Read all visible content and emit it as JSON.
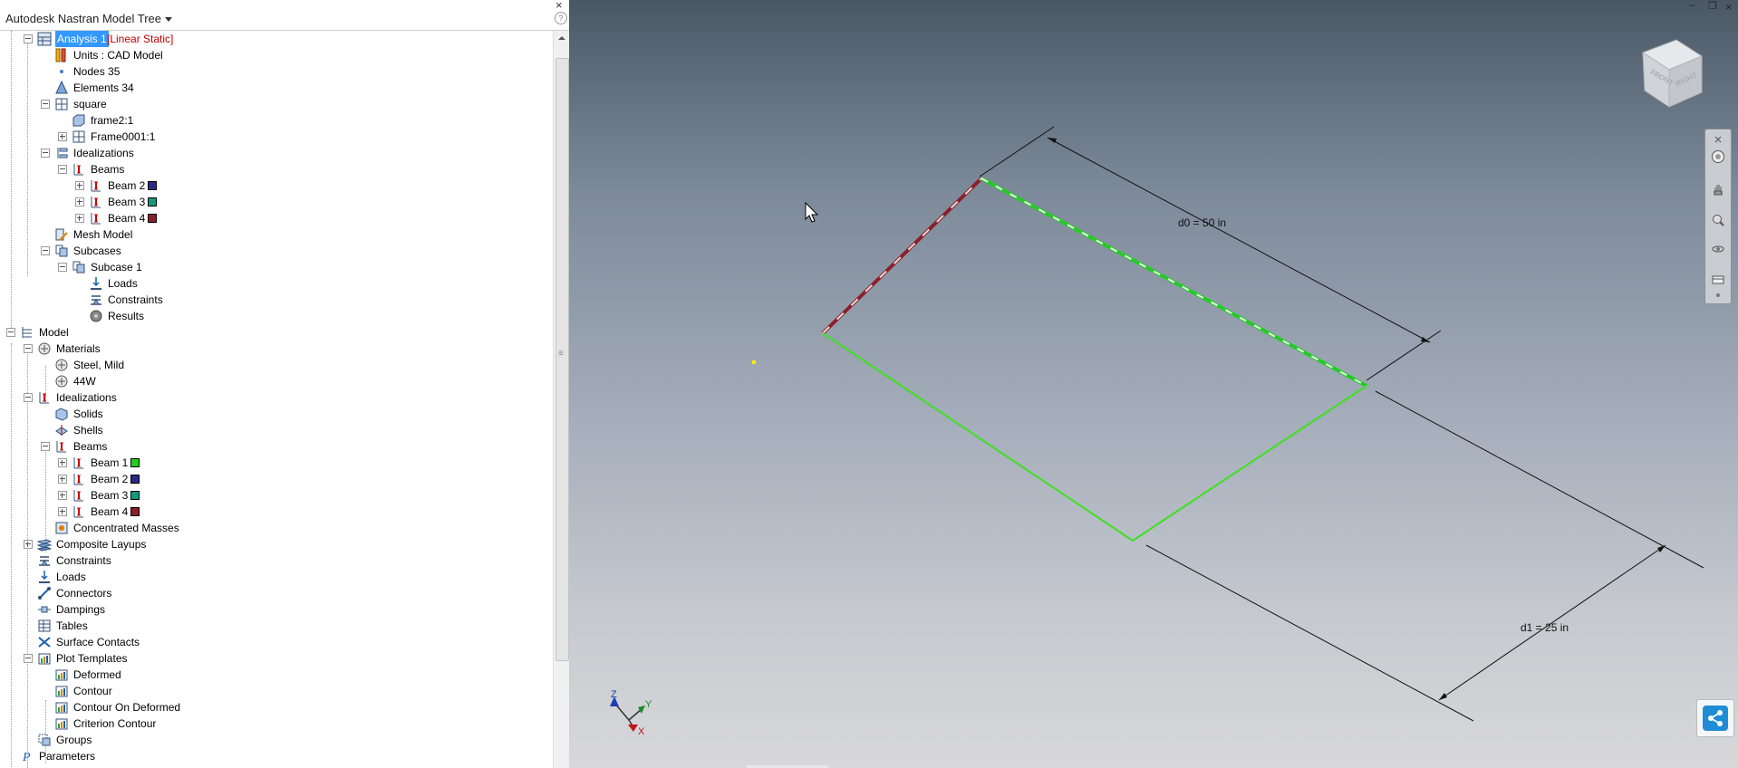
{
  "panel": {
    "title": "Autodesk Nastran Model Tree",
    "help": "?",
    "close": "×"
  },
  "tree": {
    "analysis": {
      "label": "Analysis 1",
      "type": "[Linear Static]"
    },
    "units": "Units : CAD Model",
    "nodes": "Nodes 35",
    "elements": "Elements 34",
    "square": "square",
    "frame2": "frame2:1",
    "frame0001": "Frame0001:1",
    "idealizations_a": "Idealizations",
    "beams_a": "Beams",
    "beam2_a": "Beam 2",
    "beam3_a": "Beam 3",
    "beam4_a": "Beam 4",
    "mesh_model": "Mesh Model",
    "subcases": "Subcases",
    "subcase1": "Subcase 1",
    "loads_a": "Loads",
    "constraints_a": "Constraints",
    "results": "Results",
    "model": "Model",
    "materials": "Materials",
    "steel": "Steel, Mild",
    "mat44w": "44W",
    "idealizations_b": "Idealizations",
    "solids": "Solids",
    "shells": "Shells",
    "beams_b": "Beams",
    "beam1_b": "Beam 1",
    "beam2_b": "Beam 2",
    "beam3_b": "Beam 3",
    "beam4_b": "Beam 4",
    "conc_masses": "Concentrated Masses",
    "composite": "Composite Layups",
    "constraints_b": "Constraints",
    "loads_b": "Loads",
    "connectors": "Connectors",
    "dampings": "Dampings",
    "tables": "Tables",
    "surface_contacts": "Surface Contacts",
    "plot_templates": "Plot Templates",
    "deformed": "Deformed",
    "contour": "Contour",
    "contour_deformed": "Contour On Deformed",
    "criterion_contour": "Criterion Contour",
    "groups": "Groups",
    "parameters": "Parameters"
  },
  "colors": {
    "beam1": "#22cc22",
    "beam2": "#2b2a86",
    "beam3": "#139a7c",
    "beam4": "#8a1f2a",
    "selection": "#3399ff",
    "annotation": "#c00000"
  },
  "viewport": {
    "dim_d0": "d0 = 50 in",
    "dim_d1": "d1 = 25 in",
    "axis_x": "X",
    "axis_y": "Y",
    "axis_z": "Z",
    "viewcube_front": "FRONT",
    "viewcube_right": "RIGHT",
    "win_min": "–",
    "win_max": "❐",
    "win_close": "×"
  }
}
